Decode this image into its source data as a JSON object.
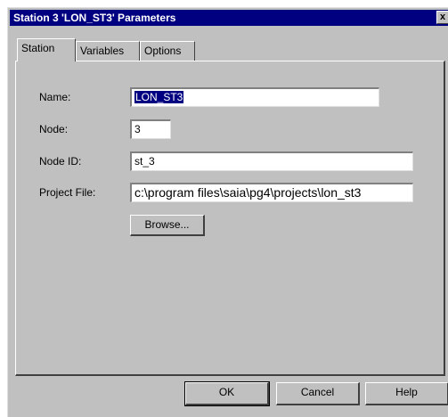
{
  "window": {
    "title": "Station 3 'LON_ST3' Parameters",
    "close_glyph": "x"
  },
  "tabs": [
    {
      "label": "Station",
      "active": true
    },
    {
      "label": "Variables",
      "active": false
    },
    {
      "label": "Options",
      "active": false
    }
  ],
  "form": {
    "name_label": "Name:",
    "name_value": "LON_ST3",
    "node_label": "Node:",
    "node_value": "3",
    "node_id_label": "Node ID:",
    "node_id_value": "st_3",
    "project_label": "Project File:",
    "project_value": "c:\\program files\\saia\\pg4\\projects\\lon_st3",
    "browse_label": "Browse..."
  },
  "buttons": {
    "ok": "OK",
    "cancel": "Cancel",
    "help": "Help"
  },
  "colors": {
    "title_bar": "#000080",
    "dialog_face": "#c0c0c0",
    "selection": "#000080"
  }
}
